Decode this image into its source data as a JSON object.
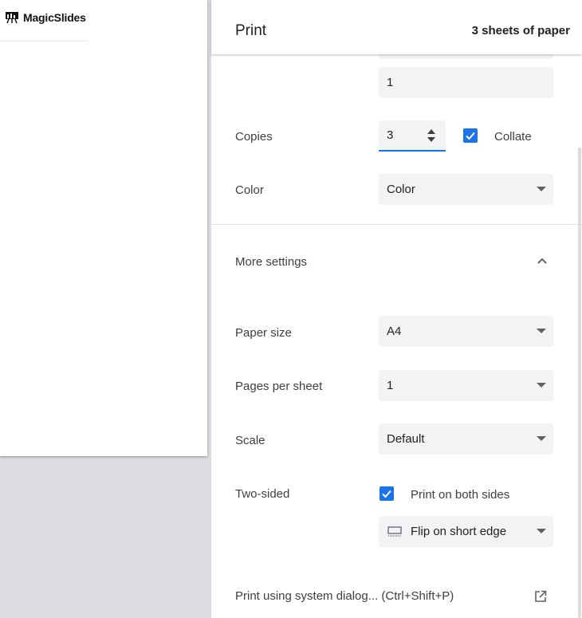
{
  "preview": {
    "brand_name": "MagicSlides"
  },
  "header": {
    "title": "Print",
    "sheets": "3 sheets of paper"
  },
  "pages_field": {
    "value": "1"
  },
  "copies": {
    "label": "Copies",
    "value": "3",
    "collate_label": "Collate",
    "collate_checked": true
  },
  "color": {
    "label": "Color",
    "value": "Color"
  },
  "more_settings": {
    "label": "More settings",
    "expanded": true
  },
  "paper_size": {
    "label": "Paper size",
    "value": "A4"
  },
  "pages_per_sheet": {
    "label": "Pages per sheet",
    "value": "1"
  },
  "scale": {
    "label": "Scale",
    "value": "Default"
  },
  "two_sided": {
    "label": "Two-sided",
    "checkbox_label": "Print on both sides",
    "checked": true,
    "flip_value": "Flip on short edge"
  },
  "system_dialog": {
    "label": "Print using system dialog... (Ctrl+Shift+P)"
  },
  "colors": {
    "accent": "#1a73e8",
    "field_bg": "#f1f3f4",
    "preview_bg": "#dadce0"
  }
}
